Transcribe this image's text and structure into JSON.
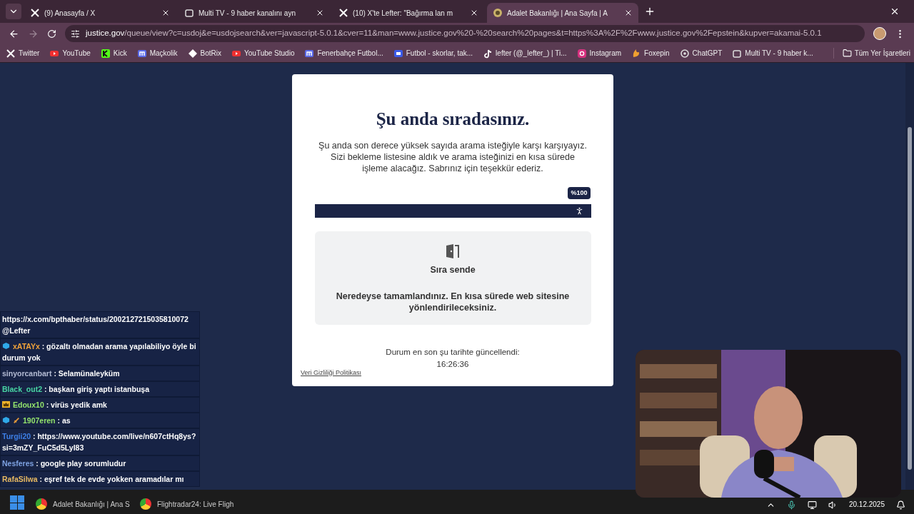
{
  "tabs": [
    {
      "title": "(9) Anasayfa / X",
      "selected": false
    },
    {
      "title": "Multi TV - 9 haber kanalını ayn",
      "selected": false
    },
    {
      "title": "(10) X'te Lefter: \"Bağırma lan m",
      "selected": false
    },
    {
      "title": "Adalet Bakanlığı | Ana Sayfa | A",
      "selected": true
    }
  ],
  "address": {
    "domain": "justice.gov",
    "path": "/queue/view?c=usdoj&e=usdojsearch&ver=javascript-5.0.1&cver=11&man=www.justice.gov%20-%20search%20pages&t=https%3A%2F%2Fwww.justice.gov%2Fepstein&kupver=akamai-5.0.1"
  },
  "bookmarks": [
    "Twitter",
    "YouTube",
    "Kick",
    "Maçkolik",
    "BotRix",
    "YouTube Studio",
    "Fenerbahçe Futbol...",
    "Futbol - skorlar, tak...",
    "lefter (@_lefter_) | Ti...",
    "Instagram",
    "Foxepin",
    "ChatGPT",
    "Multi TV - 9 haber k..."
  ],
  "all_bookmarks": "Tüm Yer İşaretleri",
  "queue": {
    "title": "Şu anda sıradasınız.",
    "intro": "Şu anda son derece yüksek sayıda arama isteğiyle karşı karşıyayız. Sizi bekleme listesine aldık ve arama isteğinizi en kısa sürede işleme alacağız. Sabrınız için teşekkür ederiz.",
    "progress": {
      "level": 1.0,
      "label": "%100"
    },
    "status_title": "Sıra sende",
    "status_text": "Neredeyse tamamlandınız. En kısa sürede web sitesine yönlendirileceksiniz.",
    "updated_label": "Durum en son şu tarihte güncellendi:",
    "updated_time": "16:26:36",
    "privacy_link": "Veri Gizliliği Politikası"
  },
  "chat": [
    {
      "text": "https://x.com/bpthaber/status/2002127215035810072 @Lefter"
    },
    {
      "name": "xATAYx",
      "color": "#f2a33a",
      "text": ": gözaltı olmadan arama yapılabiliyo öyle bi durum yok"
    },
    {
      "name": "sinyorcanbart",
      "color": "#b4bcd4",
      "text": ": Selamünaleyküm"
    },
    {
      "name": "Black_out2",
      "color": "#48d6a4",
      "text": ": başkan giriş yaptı istanbuşa"
    },
    {
      "name": "Edoux10",
      "color": "#94e46c",
      "text": ": virüs yedik amk"
    },
    {
      "name": "1907eren",
      "color": "#94e46c",
      "text": ": as"
    },
    {
      "name": "Turgii20",
      "color": "#3d7fe6",
      "text": ": https://www.youtube.com/live/n607ctHq8ys?si=3mZY_FuC5d5LyI83"
    },
    {
      "name": "Nesferes",
      "color": "#7ea2e2",
      "text": ": google play sorumludur"
    },
    {
      "name": "RafaSilwa",
      "color": "#e8ba62",
      "text": ": eşref tek de evde yokken aramadılar mı"
    }
  ],
  "taskbar": {
    "apps": [
      {
        "title": "Adalet Bakanlığı | Ana S"
      },
      {
        "title": "Flightradar24: Live Fligh"
      }
    ],
    "date": "20.12.2025"
  }
}
